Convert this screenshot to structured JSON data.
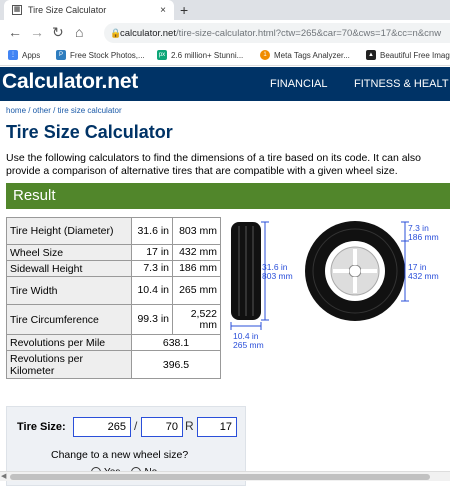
{
  "browser": {
    "tab_title": "Tire Size Calculator",
    "tab_close": "×",
    "new_tab": "+",
    "url_host": "calculator.net",
    "url_path": "/tire-size-calculator.html?ctw=265&car=70&cws=17&cc=n&cnw",
    "bookmarks": [
      {
        "label": "Apps",
        "icon_color": "#4285f4"
      },
      {
        "label": "Free Stock Photos,...",
        "icon_color": "#2e7dbf"
      },
      {
        "label": "2.6 million+ Stunni...",
        "icon_color": "#0ca678"
      },
      {
        "label": "Meta Tags Analyzer...",
        "icon_color": "#f08c00"
      },
      {
        "label": "Beautiful Free Imag",
        "icon_color": "#222222"
      }
    ]
  },
  "site": {
    "logo_main": "Calculator",
    "logo_dot": ".",
    "logo_tld": "net",
    "nav": [
      "FINANCIAL",
      "FITNESS & HEALT"
    ]
  },
  "page": {
    "breadcrumb": "home / other / tire size calculator",
    "title": "Tire Size Calculator",
    "intro": "Use the following calculators to find the dimensions of a tire based on its code. It can also provide a comparison of alternative tires that are compatible with a given wheel size.",
    "result_heading": "Result"
  },
  "results": [
    {
      "label": "Tire Height (Diameter)",
      "v1": "31.6 in",
      "v2": "803 mm"
    },
    {
      "label": "Wheel Size",
      "v1": "17 in",
      "v2": "432 mm"
    },
    {
      "label": "Sidewall Height",
      "v1": "7.3 in",
      "v2": "186 mm"
    },
    {
      "label": "Tire Width",
      "v1": "10.4 in",
      "v2": "265 mm"
    },
    {
      "label": "Tire Circumference",
      "v1": "99.3 in",
      "v2": "2,522 mm"
    },
    {
      "label": "Revolutions per Mile",
      "v": "638.1"
    },
    {
      "label": "Revolutions per Kilometer",
      "v": "396.5"
    }
  ],
  "diagram": {
    "height_in": "31.6 in",
    "height_mm": "803 mm",
    "width_in": "10.4 in",
    "width_mm": "265 mm",
    "sidewall_in": "7.3 in",
    "sidewall_mm": "186 mm",
    "wheel_in": "17 in",
    "wheel_mm": "432 mm"
  },
  "size_form": {
    "label": "Tire Size:",
    "width": "265",
    "slash": "/",
    "ratio": "70",
    "r": "R",
    "wheel": "17",
    "change_prompt": "Change to a new wheel size?",
    "opt_yes": "Yes",
    "opt_no": "No"
  }
}
